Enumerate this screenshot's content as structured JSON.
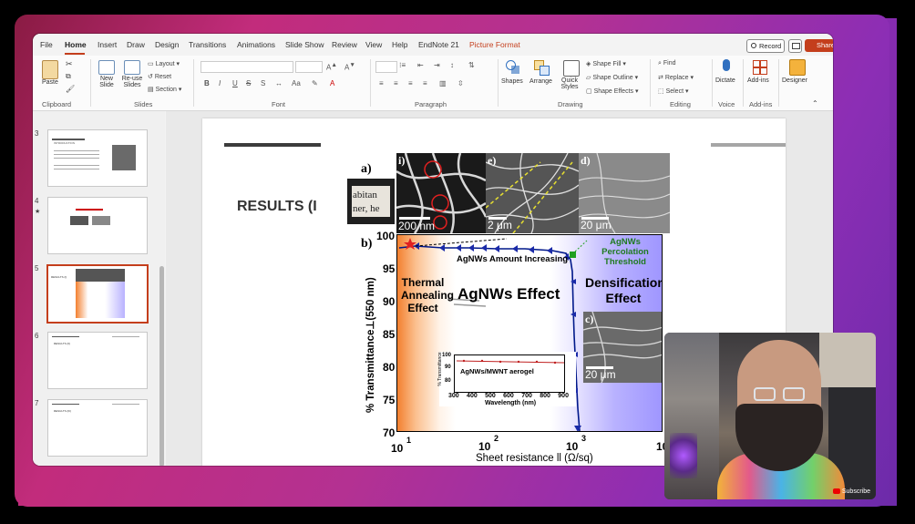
{
  "menu": {
    "items": [
      "File",
      "Home",
      "Insert",
      "Draw",
      "Design",
      "Transitions",
      "Animations",
      "Slide Show",
      "Review",
      "View",
      "Help",
      "EndNote 21",
      "Picture Format"
    ],
    "record_label": "Record",
    "share_label": "Share"
  },
  "ribbon": {
    "clipboard": {
      "paste_label": "Paste",
      "group_label": "Clipboard"
    },
    "slides": {
      "new_slide_label": "New",
      "new_slide_label2": "Slide",
      "reuse_label": "Re-use",
      "reuse_label2": "Slides",
      "layout_label": "Layout",
      "reset_label": "Reset",
      "section_label": "Section",
      "group_label": "Slides"
    },
    "font": {
      "group_label": "Font",
      "bold": "B",
      "italic": "I",
      "underline": "U",
      "strike": "S"
    },
    "paragraph": {
      "group_label": "Paragraph"
    },
    "drawing": {
      "shapes_label": "Shapes",
      "arrange_label": "Arrange",
      "quick_styles_label": "Quick",
      "quick_styles_label2": "Styles",
      "fill_label": "Shape Fill",
      "outline_label": "Shape Outline",
      "effects_label": "Shape Effects",
      "group_label": "Drawing"
    },
    "editing": {
      "find_label": "Find",
      "replace_label": "Replace",
      "select_label": "Select",
      "group_label": "Editing"
    },
    "voice": {
      "dictate_label": "Dictate",
      "group_label": "Voice"
    },
    "addins": {
      "addins_label": "Add-ins",
      "group_label": "Add-ins"
    },
    "designer": {
      "designer_label": "Designer"
    }
  },
  "thumbnails": [
    {
      "number": "3",
      "title": "INTRODUCTION"
    },
    {
      "number": "4",
      "title": ""
    },
    {
      "number": "5",
      "title": "RESULTS (I)"
    },
    {
      "number": "6",
      "title": "RESULTS (II)"
    },
    {
      "number": "7",
      "title": "RESULTS (III)"
    }
  ],
  "slide": {
    "title": "RESULTS (I"
  },
  "figure": {
    "label_a": "a)",
    "label_b": "b)",
    "label_c": "c)",
    "label_d": "d)",
    "label_e": "e)",
    "photo_text1": "abitan",
    "photo_text2": "ner, he",
    "scale_200nm": "200 nm",
    "scale_2um": "2 μm",
    "scale_20um_d": "20 μm",
    "scale_20um_c": "20 μm",
    "percolation": "AgNWs Percolation",
    "threshold": "Threshold",
    "amount": "AgNWs Amount Increasing",
    "thermal1": "Thermal",
    "thermal2": "Annealing",
    "thermal3": "Effect",
    "agnws_effect": "AgNWs Effect",
    "dens1": "Densification",
    "dens2": "Effect",
    "ylabel": "% Transmittance⊥(550 nm)",
    "xlabel": "Sheet resistance ll (Ω/sq)",
    "yticks": [
      "100",
      "95",
      "90",
      "85",
      "80",
      "75",
      "70"
    ],
    "xticks": [
      "10",
      "10",
      "10",
      "10"
    ],
    "xexp": [
      "1",
      "2",
      "3"
    ],
    "inset_legend": "AgNWs/MWNT aerogel",
    "inset_ylabel": "% Transmittance",
    "inset_xlabel": "Wavelength (nm)",
    "inset_yticks": [
      "100",
      "90",
      "80"
    ],
    "inset_xticks": [
      "300",
      "400",
      "500",
      "600",
      "700",
      "800",
      "900"
    ]
  },
  "webcam": {
    "subscribe_label": "Subscribe"
  }
}
